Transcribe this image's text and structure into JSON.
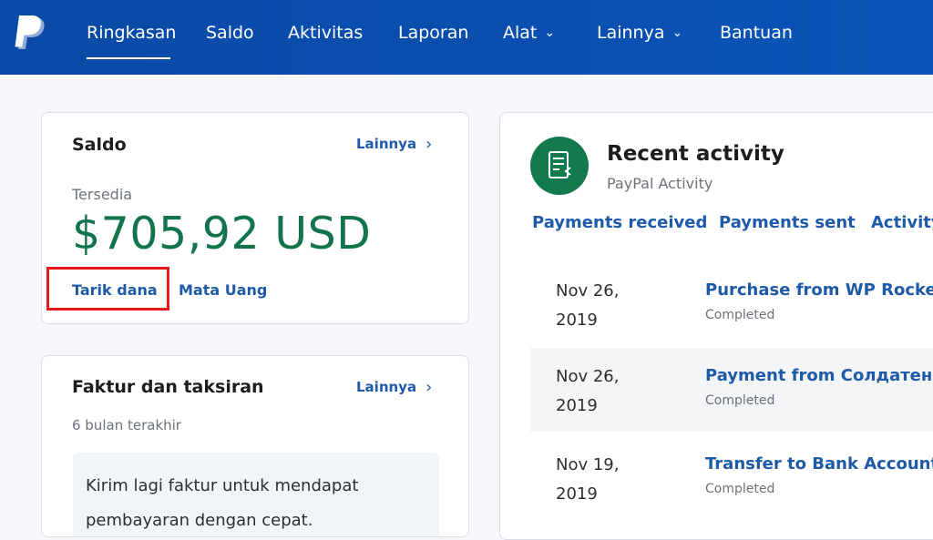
{
  "nav": {
    "items": [
      {
        "label": "Ringkasan",
        "dropdown": false,
        "active": true
      },
      {
        "label": "Saldo",
        "dropdown": false,
        "active": false
      },
      {
        "label": "Aktivitas",
        "dropdown": false,
        "active": false
      },
      {
        "label": "Laporan",
        "dropdown": false,
        "active": false
      },
      {
        "label": "Alat",
        "dropdown": true,
        "active": false
      },
      {
        "label": "Lainnya",
        "dropdown": true,
        "active": false
      },
      {
        "label": "Bantuan",
        "dropdown": false,
        "active": false
      }
    ],
    "logo_icon": "paypal-logo",
    "dropdown_icon": "chevron-down-icon",
    "chevron_glyph": "⌄"
  },
  "balance_card": {
    "title": "Saldo",
    "more_label": "Lainnya",
    "more_icon": "chevron-right-icon",
    "available_label": "Tersedia",
    "amount": "$705,92 USD",
    "withdraw_label": "Tarik dana",
    "currency_label": "Mata Uang"
  },
  "invoice_card": {
    "title": "Faktur dan taksiran",
    "more_label": "Lainnya",
    "period_label": "6 bulan terakhir",
    "message": "Kirim lagi faktur untuk mendapat pembayaran dengan cepat."
  },
  "activity_card": {
    "title": "Recent activity",
    "subtitle": "PayPal Activity",
    "icon": "document-activity-icon",
    "tabs": [
      "Payments received",
      "Payments sent",
      "Activity"
    ],
    "rows": [
      {
        "date": "Nov 26, 2019",
        "title": "Purchase from WP Rocket",
        "status": "Completed"
      },
      {
        "date": "Nov 26, 2019",
        "title": "Payment from Солдатенко",
        "status": "Completed"
      },
      {
        "date": "Nov 19, 2019",
        "title": "Transfer to Bank Account",
        "status": "Completed"
      }
    ]
  },
  "colors": {
    "header_blue": "#0b4aa6",
    "link_blue": "#1f5aa8",
    "balance_green": "#12744a",
    "highlight_red": "#e51b1b"
  }
}
